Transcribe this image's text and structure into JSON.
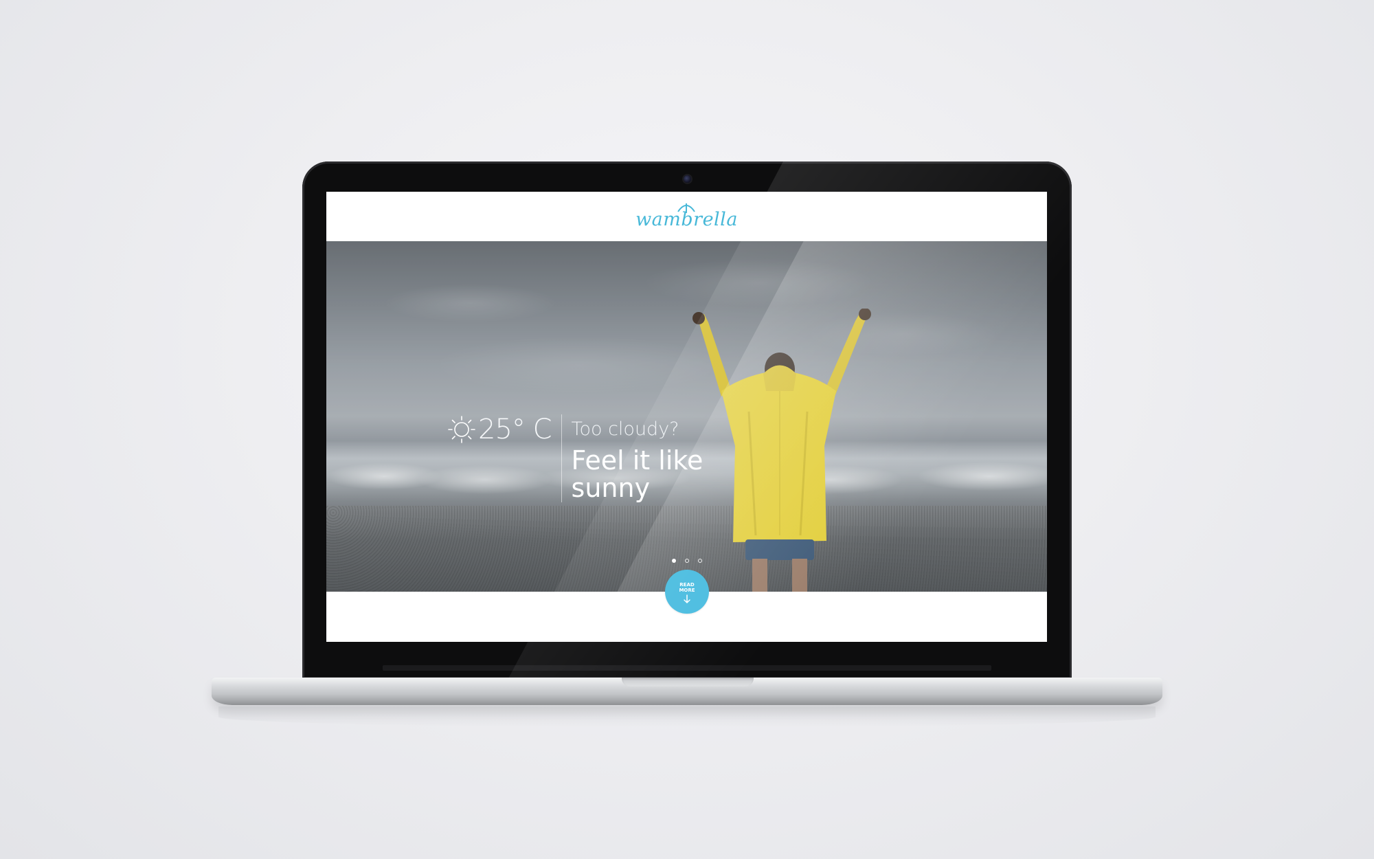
{
  "site": {
    "logo_text": "wambrella"
  },
  "hero": {
    "temperature": "25° C",
    "weather_icon": "sun-icon",
    "tagline_small": "Too cloudy?",
    "tagline_big": "Feel it like sunny",
    "carousel": {
      "total_slides": 3,
      "active_index": 0
    }
  },
  "cta": {
    "read_more_label": "READ MORE",
    "icon": "arrow-down-icon"
  },
  "colors": {
    "brand": "#47b8d8",
    "button": "#4cbde0",
    "raincoat": "#e3cf3c"
  }
}
